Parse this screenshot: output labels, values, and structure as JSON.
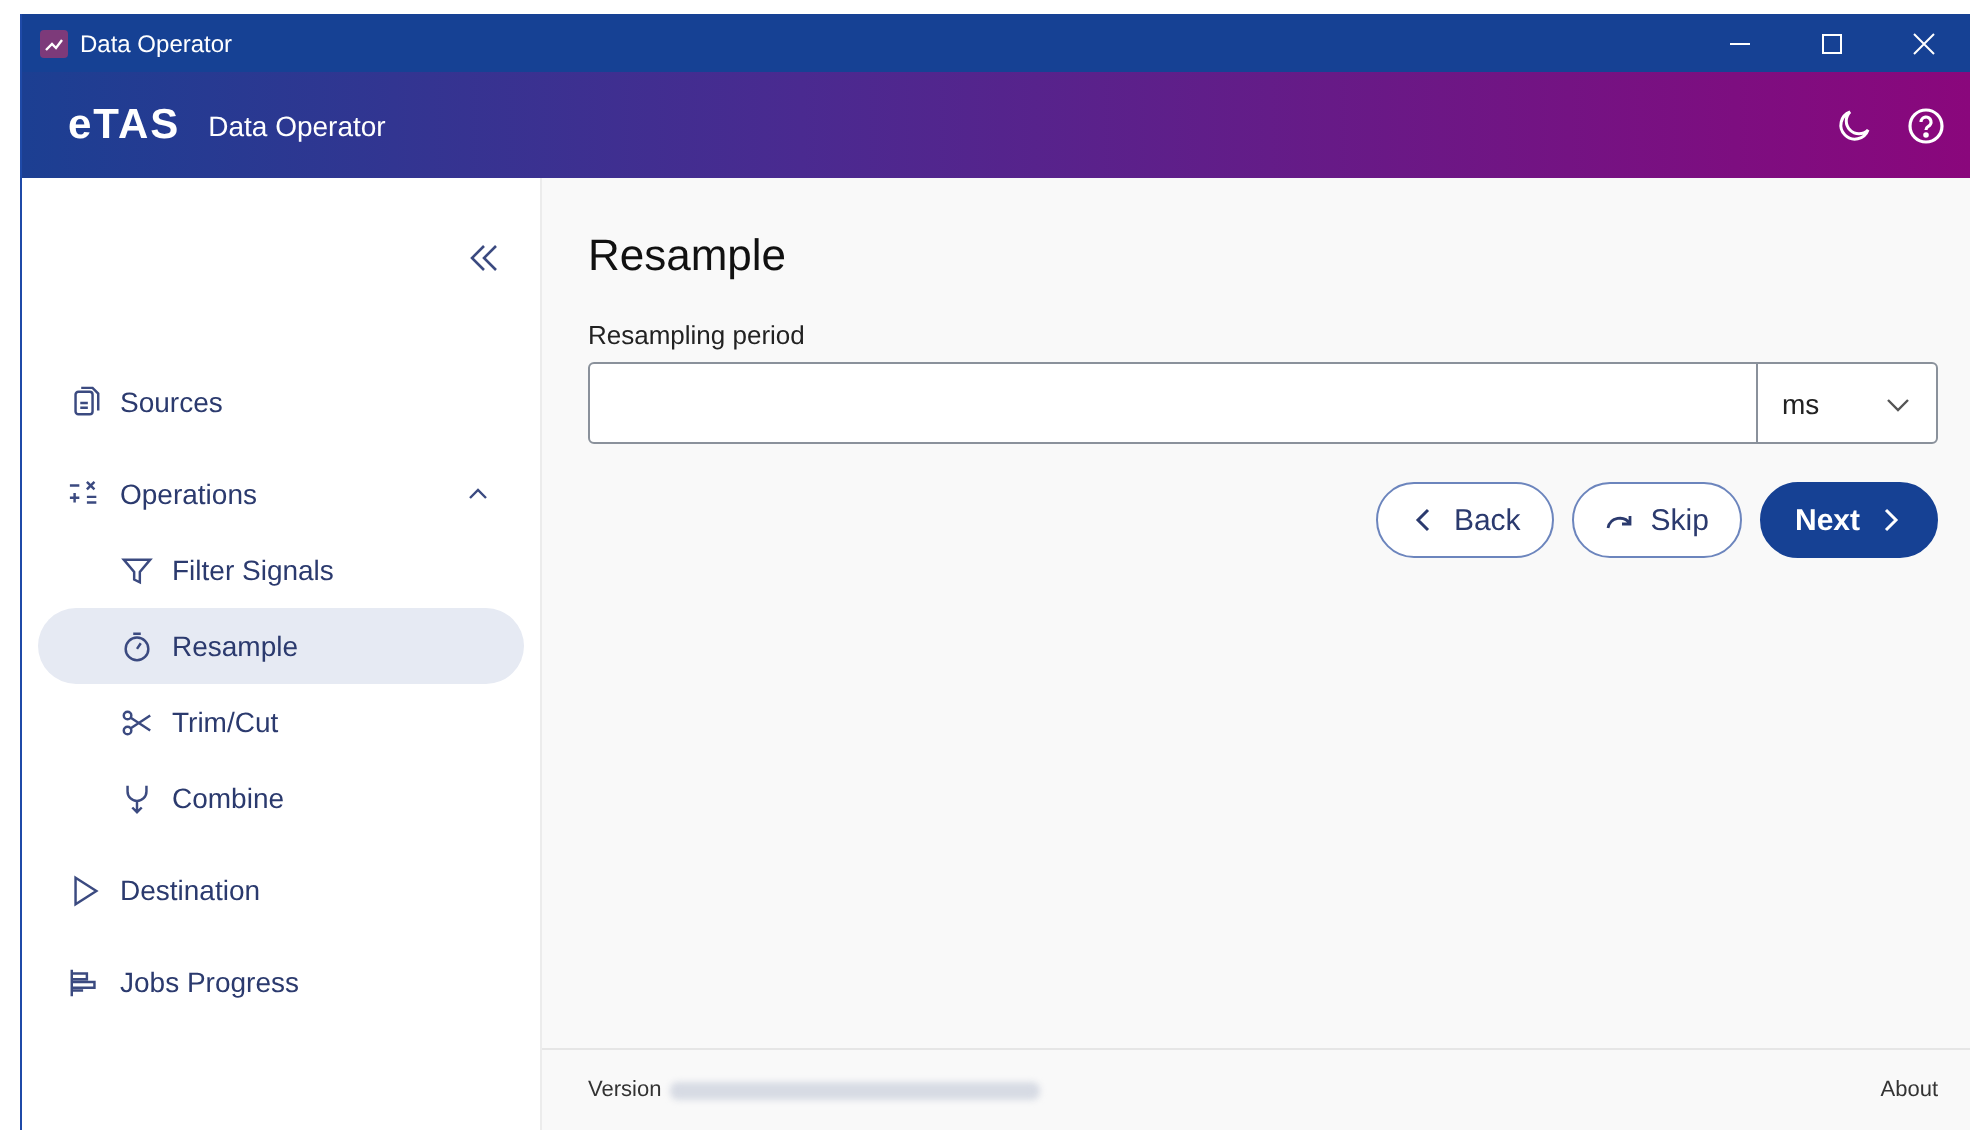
{
  "window": {
    "title": "Data Operator"
  },
  "header": {
    "logo": "eTAS",
    "app_name": "Data Operator"
  },
  "sidebar": {
    "items": [
      {
        "label": "Sources",
        "selected": false
      },
      {
        "label": "Operations",
        "selected": false,
        "expanded": true,
        "children": [
          {
            "label": "Filter Signals",
            "selected": false
          },
          {
            "label": "Resample",
            "selected": true
          },
          {
            "label": "Trim/Cut",
            "selected": false
          },
          {
            "label": "Combine",
            "selected": false
          }
        ]
      },
      {
        "label": "Destination",
        "selected": false
      },
      {
        "label": "Jobs Progress",
        "selected": false
      }
    ]
  },
  "page": {
    "title": "Resample",
    "field": {
      "label": "Resampling period",
      "unit": "ms"
    },
    "buttons": [
      {
        "kind": "back",
        "label": "Back"
      },
      {
        "kind": "skip",
        "label": "Skip"
      },
      {
        "kind": "next",
        "label": "Next"
      }
    ]
  },
  "footer": {
    "version_label": "Version",
    "version_blurred": true,
    "about": "About"
  }
}
